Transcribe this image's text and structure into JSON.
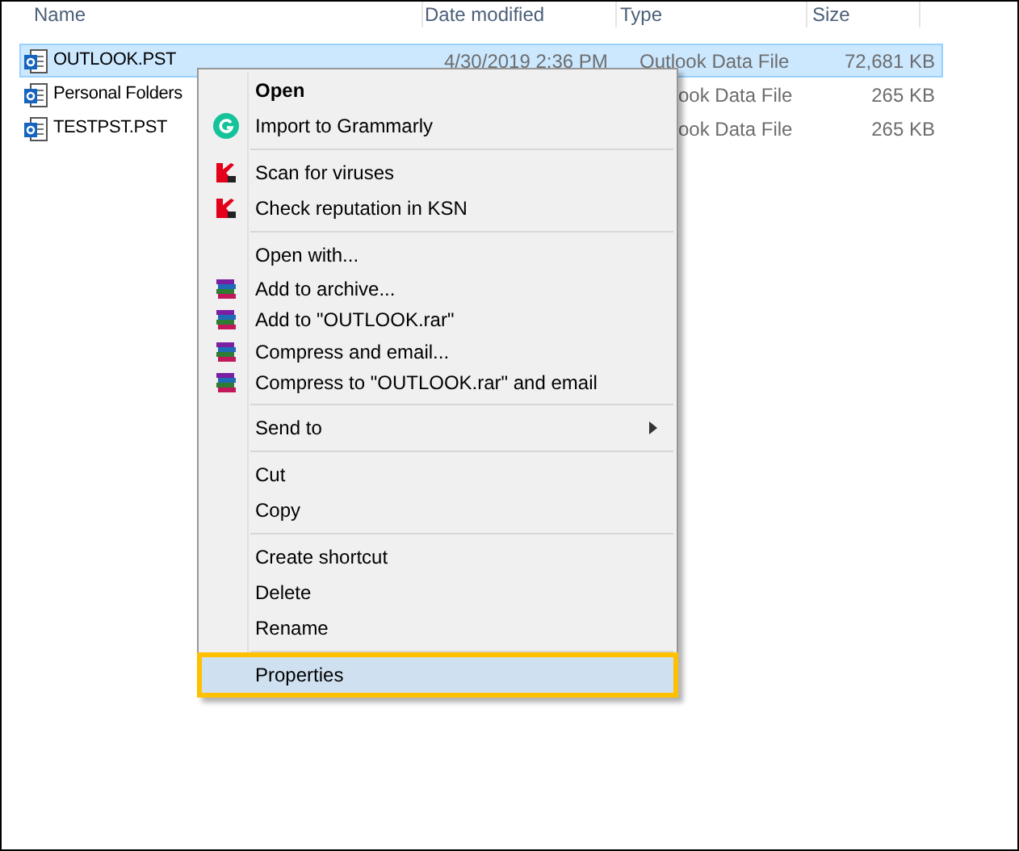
{
  "columns": [
    "Name",
    "Date modified",
    "Type",
    "Size"
  ],
  "rows": [
    {
      "name": "OUTLOOK.PST",
      "date": "4/30/2019 2:36 PM",
      "type": "Outlook Data File",
      "size": "72,681 KB",
      "selected": true
    },
    {
      "name": "Personal Folders",
      "type": "ook Data File",
      "size": "265 KB",
      "selected": false
    },
    {
      "name": "TESTPST.PST",
      "type": "ook Data File",
      "size": "265 KB",
      "selected": false
    }
  ],
  "context_menu": {
    "items": [
      {
        "kind": "plain",
        "label": "Open",
        "bold": true,
        "selected": false
      },
      {
        "kind": "grammarly",
        "label": "Import to Grammarly",
        "bold": false,
        "selected": false
      },
      {
        "kind": "separator"
      },
      {
        "kind": "scan",
        "label": "Scan for viruses",
        "bold": false,
        "selected": false
      },
      {
        "kind": "scan",
        "label": "Check reputation in KSN",
        "bold": false,
        "selected": false
      },
      {
        "kind": "separator"
      },
      {
        "kind": "plain",
        "label": "Open with...",
        "bold": false,
        "selected": false
      },
      {
        "kind": "archive",
        "label": "Add to archive...",
        "bold": false,
        "selected": false
      },
      {
        "kind": "archive",
        "label": "Add to \"OUTLOOK.rar\"",
        "bold": false,
        "selected": false
      },
      {
        "kind": "archive",
        "label": "Compress and email...",
        "bold": false,
        "selected": false
      },
      {
        "kind": "archive",
        "label": "Compress to \"OUTLOOK.rar\" and email",
        "bold": false,
        "selected": false
      },
      {
        "kind": "separator"
      },
      {
        "kind": "submenu",
        "label": "Send to",
        "bold": false,
        "selected": false
      },
      {
        "kind": "separator"
      },
      {
        "kind": "plain",
        "label": "Cut",
        "bold": false,
        "selected": false
      },
      {
        "kind": "plain",
        "label": "Copy",
        "bold": false,
        "selected": false
      },
      {
        "kind": "separator"
      },
      {
        "kind": "plain",
        "label": "Create shortcut",
        "bold": false,
        "selected": false
      },
      {
        "kind": "plain",
        "label": "Delete",
        "bold": false,
        "selected": false
      },
      {
        "kind": "plain",
        "label": "Rename",
        "bold": false,
        "selected": false
      },
      {
        "kind": "separator"
      },
      {
        "kind": "plain",
        "label": "Properties",
        "bold": false,
        "selected": true
      }
    ]
  }
}
